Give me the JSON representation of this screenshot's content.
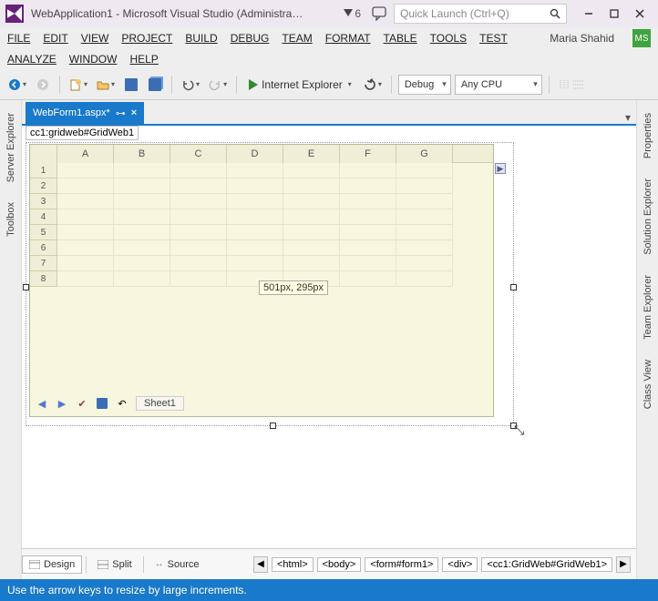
{
  "title": "WebApplication1 - Microsoft Visual Studio (Administra…",
  "notifications": "6",
  "quicklaunch_placeholder": "Quick Launch (Ctrl+Q)",
  "menu": {
    "row1": [
      "FILE",
      "EDIT",
      "VIEW",
      "PROJECT",
      "BUILD",
      "DEBUG",
      "TEAM",
      "FORMAT",
      "TABLE",
      "TOOLS",
      "TEST"
    ],
    "row2": [
      "ANALYZE",
      "WINDOW",
      "HELP"
    ],
    "user": "Maria Shahid",
    "avatar": "MS"
  },
  "toolbar": {
    "run_label": "Internet Explorer",
    "config": "Debug",
    "platform": "Any CPU"
  },
  "left_tabs": [
    "Server Explorer",
    "Toolbox"
  ],
  "right_tabs": [
    "Properties",
    "Solution Explorer",
    "Team Explorer",
    "Class View"
  ],
  "doc_tab": "WebForm1.aspx*",
  "tag_selector": "cc1:gridweb#GridWeb1",
  "grid": {
    "cols": [
      "A",
      "B",
      "C",
      "D",
      "E",
      "F",
      "G"
    ],
    "rows": [
      "1",
      "2",
      "3",
      "4",
      "5",
      "6",
      "7",
      "8"
    ],
    "sheet": "Sheet1"
  },
  "resize_tip": "501px, 295px",
  "view_tabs": {
    "design": "Design",
    "split": "Split",
    "source": "Source"
  },
  "breadcrumb": [
    "<html>",
    "<body>",
    "<form#form1>",
    "<div>",
    "<cc1:GridWeb#GridWeb1>"
  ],
  "statusbar": "Use the arrow keys to resize by large increments."
}
